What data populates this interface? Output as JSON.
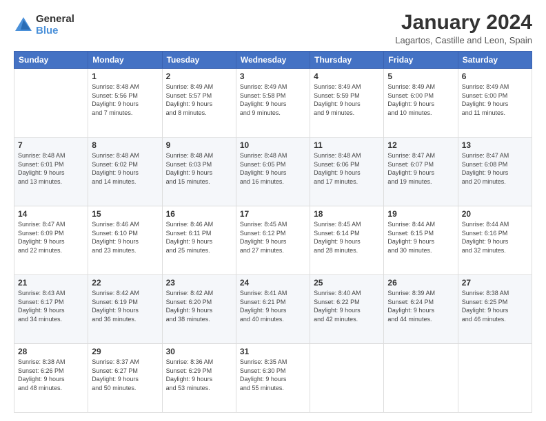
{
  "logo": {
    "general": "General",
    "blue": "Blue"
  },
  "header": {
    "month_year": "January 2024",
    "location": "Lagartos, Castille and Leon, Spain"
  },
  "weekdays": [
    "Sunday",
    "Monday",
    "Tuesday",
    "Wednesday",
    "Thursday",
    "Friday",
    "Saturday"
  ],
  "weeks": [
    [
      {
        "day": "",
        "content": ""
      },
      {
        "day": "1",
        "content": "Sunrise: 8:48 AM\nSunset: 5:56 PM\nDaylight: 9 hours\nand 7 minutes."
      },
      {
        "day": "2",
        "content": "Sunrise: 8:49 AM\nSunset: 5:57 PM\nDaylight: 9 hours\nand 8 minutes."
      },
      {
        "day": "3",
        "content": "Sunrise: 8:49 AM\nSunset: 5:58 PM\nDaylight: 9 hours\nand 9 minutes."
      },
      {
        "day": "4",
        "content": "Sunrise: 8:49 AM\nSunset: 5:59 PM\nDaylight: 9 hours\nand 9 minutes."
      },
      {
        "day": "5",
        "content": "Sunrise: 8:49 AM\nSunset: 6:00 PM\nDaylight: 9 hours\nand 10 minutes."
      },
      {
        "day": "6",
        "content": "Sunrise: 8:49 AM\nSunset: 6:00 PM\nDaylight: 9 hours\nand 11 minutes."
      }
    ],
    [
      {
        "day": "7",
        "content": "Sunrise: 8:48 AM\nSunset: 6:01 PM\nDaylight: 9 hours\nand 13 minutes."
      },
      {
        "day": "8",
        "content": "Sunrise: 8:48 AM\nSunset: 6:02 PM\nDaylight: 9 hours\nand 14 minutes."
      },
      {
        "day": "9",
        "content": "Sunrise: 8:48 AM\nSunset: 6:03 PM\nDaylight: 9 hours\nand 15 minutes."
      },
      {
        "day": "10",
        "content": "Sunrise: 8:48 AM\nSunset: 6:05 PM\nDaylight: 9 hours\nand 16 minutes."
      },
      {
        "day": "11",
        "content": "Sunrise: 8:48 AM\nSunset: 6:06 PM\nDaylight: 9 hours\nand 17 minutes."
      },
      {
        "day": "12",
        "content": "Sunrise: 8:47 AM\nSunset: 6:07 PM\nDaylight: 9 hours\nand 19 minutes."
      },
      {
        "day": "13",
        "content": "Sunrise: 8:47 AM\nSunset: 6:08 PM\nDaylight: 9 hours\nand 20 minutes."
      }
    ],
    [
      {
        "day": "14",
        "content": "Sunrise: 8:47 AM\nSunset: 6:09 PM\nDaylight: 9 hours\nand 22 minutes."
      },
      {
        "day": "15",
        "content": "Sunrise: 8:46 AM\nSunset: 6:10 PM\nDaylight: 9 hours\nand 23 minutes."
      },
      {
        "day": "16",
        "content": "Sunrise: 8:46 AM\nSunset: 6:11 PM\nDaylight: 9 hours\nand 25 minutes."
      },
      {
        "day": "17",
        "content": "Sunrise: 8:45 AM\nSunset: 6:12 PM\nDaylight: 9 hours\nand 27 minutes."
      },
      {
        "day": "18",
        "content": "Sunrise: 8:45 AM\nSunset: 6:14 PM\nDaylight: 9 hours\nand 28 minutes."
      },
      {
        "day": "19",
        "content": "Sunrise: 8:44 AM\nSunset: 6:15 PM\nDaylight: 9 hours\nand 30 minutes."
      },
      {
        "day": "20",
        "content": "Sunrise: 8:44 AM\nSunset: 6:16 PM\nDaylight: 9 hours\nand 32 minutes."
      }
    ],
    [
      {
        "day": "21",
        "content": "Sunrise: 8:43 AM\nSunset: 6:17 PM\nDaylight: 9 hours\nand 34 minutes."
      },
      {
        "day": "22",
        "content": "Sunrise: 8:42 AM\nSunset: 6:19 PM\nDaylight: 9 hours\nand 36 minutes."
      },
      {
        "day": "23",
        "content": "Sunrise: 8:42 AM\nSunset: 6:20 PM\nDaylight: 9 hours\nand 38 minutes."
      },
      {
        "day": "24",
        "content": "Sunrise: 8:41 AM\nSunset: 6:21 PM\nDaylight: 9 hours\nand 40 minutes."
      },
      {
        "day": "25",
        "content": "Sunrise: 8:40 AM\nSunset: 6:22 PM\nDaylight: 9 hours\nand 42 minutes."
      },
      {
        "day": "26",
        "content": "Sunrise: 8:39 AM\nSunset: 6:24 PM\nDaylight: 9 hours\nand 44 minutes."
      },
      {
        "day": "27",
        "content": "Sunrise: 8:38 AM\nSunset: 6:25 PM\nDaylight: 9 hours\nand 46 minutes."
      }
    ],
    [
      {
        "day": "28",
        "content": "Sunrise: 8:38 AM\nSunset: 6:26 PM\nDaylight: 9 hours\nand 48 minutes."
      },
      {
        "day": "29",
        "content": "Sunrise: 8:37 AM\nSunset: 6:27 PM\nDaylight: 9 hours\nand 50 minutes."
      },
      {
        "day": "30",
        "content": "Sunrise: 8:36 AM\nSunset: 6:29 PM\nDaylight: 9 hours\nand 53 minutes."
      },
      {
        "day": "31",
        "content": "Sunrise: 8:35 AM\nSunset: 6:30 PM\nDaylight: 9 hours\nand 55 minutes."
      },
      {
        "day": "",
        "content": ""
      },
      {
        "day": "",
        "content": ""
      },
      {
        "day": "",
        "content": ""
      }
    ]
  ]
}
